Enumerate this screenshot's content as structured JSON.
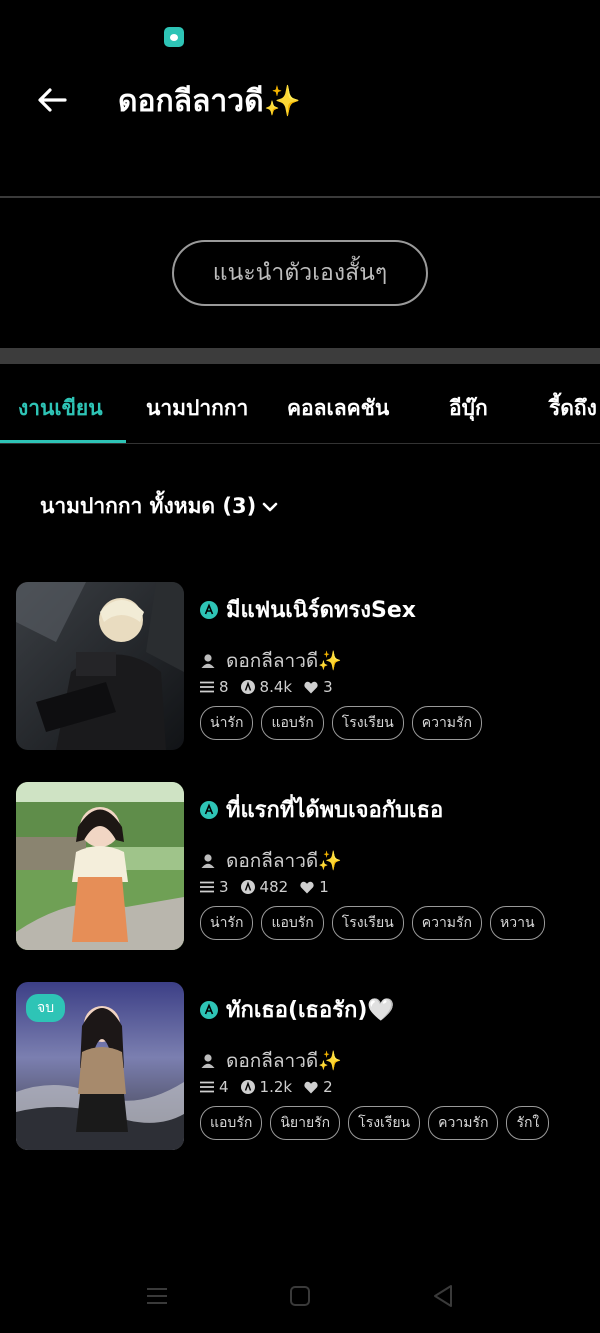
{
  "header": {
    "title": "ดอกลีลาวดี✨",
    "back_icon": "arrow-left-icon"
  },
  "intro_button_label": "แนะนำตัวเองสั้นๆ",
  "tabs": [
    {
      "label": "งานเขียน",
      "active": true
    },
    {
      "label": "นามปากกา",
      "active": false
    },
    {
      "label": "คอลเลคชัน",
      "active": false
    },
    {
      "label": "อีบุ๊ก",
      "active": false
    },
    {
      "label": "รี้ดถึง",
      "active": false
    }
  ],
  "filter": {
    "label": "นามปากกา ทั้งหมด (3)",
    "icon": "chevron-down-icon"
  },
  "works": [
    {
      "title": "มีแฟนเนิร์ดทรงSex",
      "author": "ดอกลีลาวดี✨",
      "chapters": "8",
      "views": "8.4k",
      "likes": "3",
      "tags": [
        "น่ารัก",
        "แอบรัก",
        "โรงเรียน",
        "ความรัก"
      ],
      "badge": ""
    },
    {
      "title": "ที่แรกที่ได้พบเจอกับเธอ",
      "author": "ดอกลีลาวดี✨",
      "chapters": "3",
      "views": "482",
      "likes": "1",
      "tags": [
        "น่ารัก",
        "แอบรัก",
        "โรงเรียน",
        "ความรัก",
        "หวาน"
      ],
      "badge": ""
    },
    {
      "title": "ทักเธอ(เธอรัก)🤍",
      "author": "ดอกลีลาวดี✨",
      "chapters": "4",
      "views": "1.2k",
      "likes": "2",
      "tags": [
        "แอบรัก",
        "นิยายรัก",
        "โรงเรียน",
        "ความรัก",
        "รักใ"
      ],
      "badge": "จบ"
    }
  ],
  "colors": {
    "accent": "#2ec4b6",
    "background": "#000000",
    "divider": "#3c3c3c"
  },
  "nav_icons": [
    "recent-apps-icon",
    "home-icon",
    "back-triangle-icon"
  ]
}
